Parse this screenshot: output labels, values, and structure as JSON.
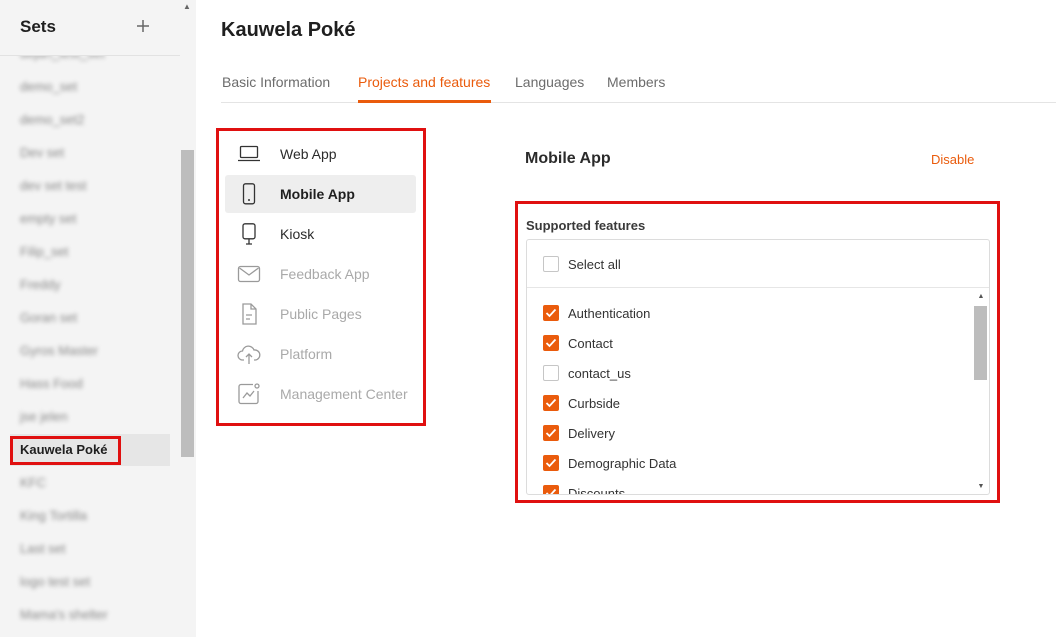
{
  "sidebar": {
    "title": "Sets",
    "add_icon": "plus-icon",
    "items": [
      {
        "label": "dejan_test_set",
        "blurred": true
      },
      {
        "label": "demo_set",
        "blurred": true
      },
      {
        "label": "demo_set2",
        "blurred": true
      },
      {
        "label": "Dev set",
        "blurred": true
      },
      {
        "label": "dev set test",
        "blurred": true
      },
      {
        "label": "empty set",
        "blurred": true
      },
      {
        "label": "Filip_set",
        "blurred": true
      },
      {
        "label": "Freddy",
        "blurred": true
      },
      {
        "label": "Goran set",
        "blurred": true
      },
      {
        "label": "Gyros Master",
        "blurred": true
      },
      {
        "label": "Hass Food",
        "blurred": true
      },
      {
        "label": "jse jelen",
        "blurred": true
      },
      {
        "label": "Kauwela Poké",
        "blurred": false,
        "active": true
      },
      {
        "label": "KFC",
        "blurred": true
      },
      {
        "label": "King Tortilla",
        "blurred": true
      },
      {
        "label": "Last set",
        "blurred": true
      },
      {
        "label": "logo test set",
        "blurred": true
      },
      {
        "label": "Mama's shelter",
        "blurred": true
      }
    ]
  },
  "page": {
    "title": "Kauwela Poké",
    "tabs": [
      {
        "label": "Basic Information",
        "active": false
      },
      {
        "label": "Projects and features",
        "active": true
      },
      {
        "label": "Languages",
        "active": false
      },
      {
        "label": "Members",
        "active": false
      }
    ]
  },
  "projects": [
    {
      "label": "Web App",
      "icon": "laptop-icon",
      "state": "enabled"
    },
    {
      "label": "Mobile App",
      "icon": "mobile-phone-icon",
      "state": "active"
    },
    {
      "label": "Kiosk",
      "icon": "kiosk-icon",
      "state": "enabled"
    },
    {
      "label": "Feedback App",
      "icon": "envelope-icon",
      "state": "disabled"
    },
    {
      "label": "Public Pages",
      "icon": "document-icon",
      "state": "disabled"
    },
    {
      "label": "Platform",
      "icon": "cloud-upload-icon",
      "state": "disabled"
    },
    {
      "label": "Management Center",
      "icon": "analytics-icon",
      "state": "disabled"
    }
  ],
  "detail": {
    "title": "Mobile App",
    "disable_label": "Disable",
    "features_label": "Supported features",
    "select_all_label": "Select all",
    "select_all_checked": false,
    "features": [
      {
        "label": "Authentication",
        "checked": true
      },
      {
        "label": "Contact",
        "checked": true
      },
      {
        "label": "contact_us",
        "checked": false
      },
      {
        "label": "Curbside",
        "checked": true
      },
      {
        "label": "Delivery",
        "checked": true
      },
      {
        "label": "Demographic Data",
        "checked": true
      },
      {
        "label": "Discounts",
        "checked": true
      }
    ]
  },
  "colors": {
    "accent": "#ea5b0c",
    "highlight": "#e01010"
  }
}
